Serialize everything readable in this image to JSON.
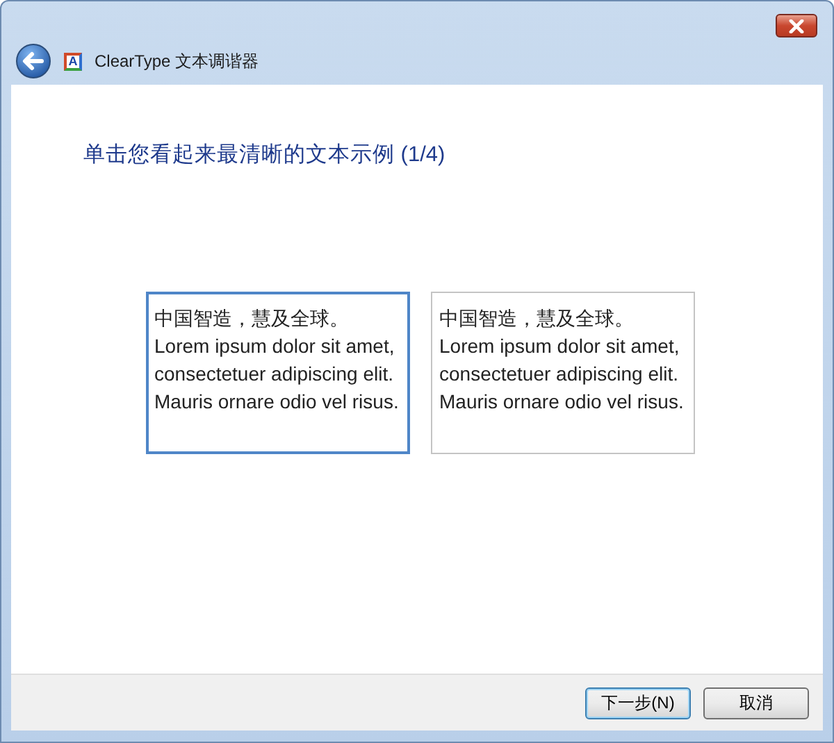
{
  "window": {
    "title": "ClearType 文本调谐器",
    "app_icon_letter": "A"
  },
  "heading": "单击您看起来最清晰的文本示例 (1/4)",
  "samples": [
    {
      "text": "中国智造，慧及全球。 Lorem ipsum dolor sit amet, consectetuer adipiscing elit. Mauris ornare odio vel risus.",
      "selected": true
    },
    {
      "text": "中国智造，慧及全球。 Lorem ipsum dolor sit amet, consectetuer adipiscing elit. Mauris ornare odio vel risus.",
      "selected": false
    }
  ],
  "buttons": [
    "下一步(N)",
    "取消"
  ]
}
